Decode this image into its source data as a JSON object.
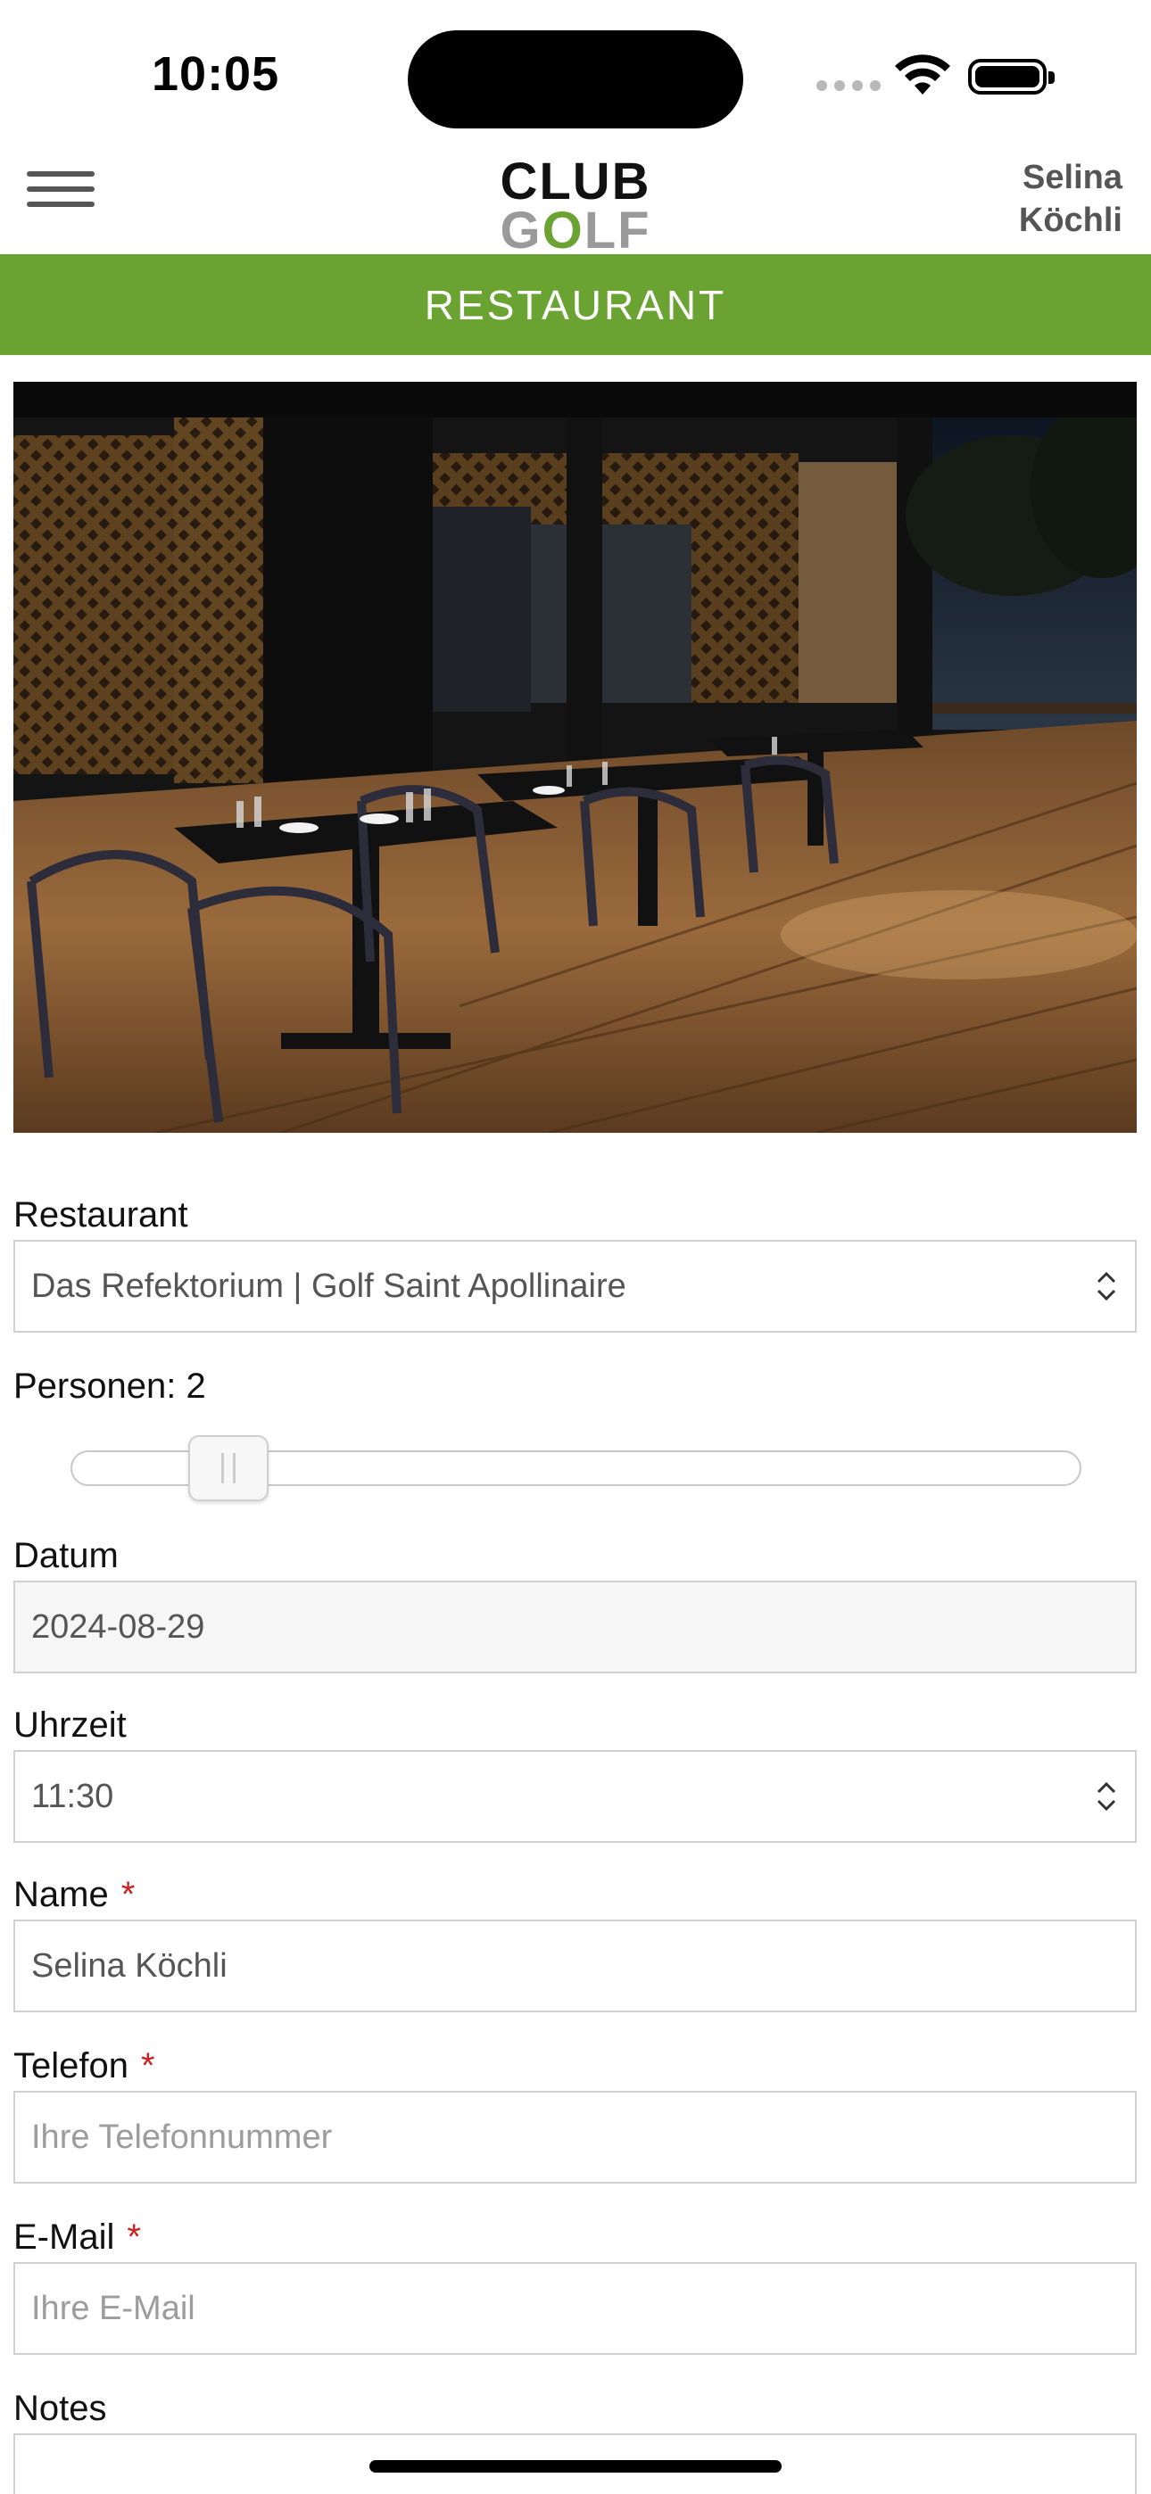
{
  "status": {
    "time": "10:05"
  },
  "header": {
    "logo_line1": "CLUB",
    "logo_line2_a": "G",
    "logo_line2_o": "O",
    "logo_line2_b": "LF",
    "user_first": "Selina",
    "user_last": "Köchli"
  },
  "banner": {
    "title": "RESTAURANT"
  },
  "colors": {
    "brand_green": "#6aa332",
    "required": "#cc2222"
  },
  "form": {
    "restaurant": {
      "label": "Restaurant",
      "value": "Das Refektorium | Golf Saint Apollinaire"
    },
    "persons": {
      "label": "Personen: 2",
      "value": 2,
      "fraction": 0.115
    },
    "date": {
      "label": "Datum",
      "value": "2024-08-29"
    },
    "time": {
      "label": "Uhrzeit",
      "value": "11:30"
    },
    "name": {
      "label": "Name",
      "required": "*",
      "value": "Selina Köchli"
    },
    "phone": {
      "label": "Telefon",
      "required": "*",
      "placeholder": "Ihre Telefonnummer"
    },
    "email": {
      "label": "E-Mail",
      "required": "*",
      "placeholder": "Ihre E-Mail"
    },
    "notes": {
      "label": "Notes"
    }
  },
  "icons": {
    "menu": "hamburger-icon",
    "select_arrow": "chevron-updown-icon",
    "wifi": "wifi-icon",
    "battery": "battery-icon"
  }
}
